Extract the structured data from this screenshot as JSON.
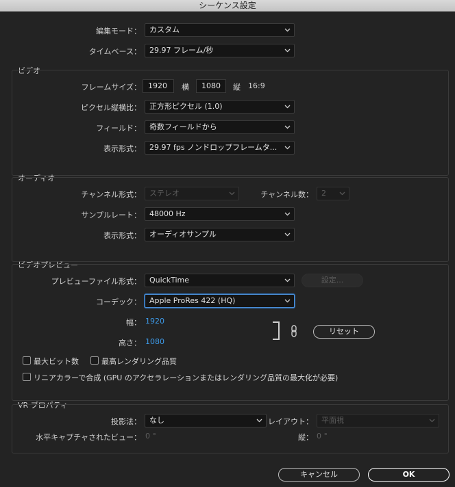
{
  "window": {
    "title": "シーケンス設定"
  },
  "general": {
    "edit_mode_label": "編集モード：",
    "edit_mode_value": "カスタム",
    "timebase_label": "タイムベース：",
    "timebase_value": "29.97  フレーム/秒"
  },
  "video": {
    "section_title": "ビデオ",
    "frame_size_label": "フレームサイズ：",
    "width_value": "1920",
    "horizontal_label": "横",
    "height_value": "1080",
    "vertical_label": "縦",
    "aspect_ratio": "16:9",
    "pixel_aspect_label": "ピクセル縦横比：",
    "pixel_aspect_value": "正方形ピクセル (1.0)",
    "fields_label": "フィールド：",
    "fields_value": "奇数フィールドから",
    "display_format_label": "表示形式：",
    "display_format_value": "29.97 fps ノンドロップフレームタ..."
  },
  "audio": {
    "section_title": "オーディオ",
    "channel_format_label": "チャンネル形式：",
    "channel_format_value": "ステレオ",
    "channel_count_label": "チャンネル数：",
    "channel_count_value": "2",
    "sample_rate_label": "サンプルレート：",
    "sample_rate_value": "48000 Hz",
    "display_format_label": "表示形式：",
    "display_format_value": "オーディオサンプル"
  },
  "preview": {
    "section_title": "ビデオプレビュー",
    "file_format_label": "プレビューファイル形式：",
    "file_format_value": "QuickTime",
    "settings_button": "設定...",
    "codec_label": "コーデック：",
    "codec_value": "Apple ProRes 422 (HQ)",
    "width_label": "幅：",
    "width_value": "1920",
    "height_label": "高さ：",
    "height_value": "1080",
    "reset_button": "リセット",
    "max_bit_depth": "最大ビット数",
    "max_render_quality": "最高レンダリング品質",
    "linear_color": "リニアカラーで合成 (GPU のアクセラレーションまたはレンダリング品質の最大化が必要)"
  },
  "vr": {
    "section_title": "VR プロパティ",
    "projection_label": "投影法：",
    "projection_value": "なし",
    "layout_label": "レイアウト：",
    "layout_value": "平面視",
    "h_capture_label": "水平キャプチャされたビュー：",
    "h_capture_value": "0 °",
    "vertical_label": "縦：",
    "vertical_value": "0 °"
  },
  "footer": {
    "cancel": "キャンセル",
    "ok": "OK"
  },
  "icons": {
    "chevron": "chevron-down-icon",
    "link": "link-icon"
  },
  "colors": {
    "accent": "#3d9bea",
    "focus": "#4a8ed8"
  }
}
